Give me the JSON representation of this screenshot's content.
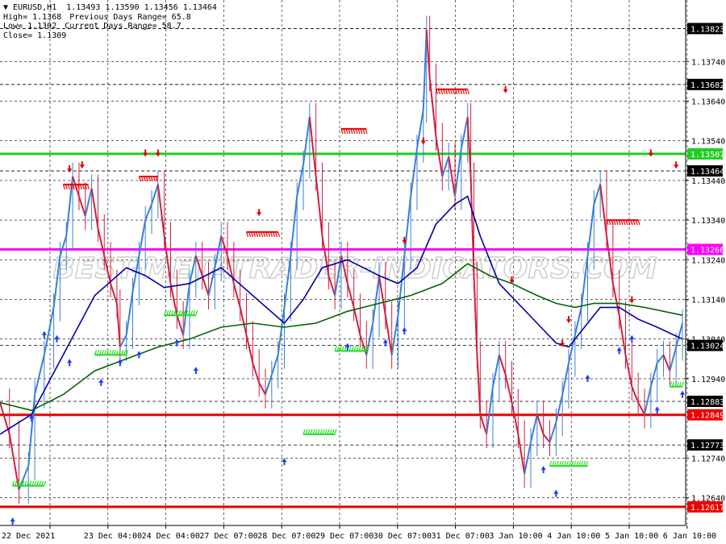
{
  "header": {
    "symbol_line": "▼ EURUSD,H1  1.13493 1.13590 1.13456 1.13464",
    "high": "High= 1.1368",
    "low": "Low= 1.1302",
    "close": "Close= 1.1309",
    "prev_range": "Previous Days Range= 65.8",
    "curr_range": "Current Days Range= 58.7"
  },
  "watermark": "BEST-METATRADER-INDICATORS.COM",
  "chart_data": {
    "type": "line",
    "ylim": [
      1.1257,
      1.13895
    ],
    "price_ticks": [
      "1.13740",
      "1.13640",
      "1.13540",
      "1.13440",
      "1.13340",
      "1.13240",
      "1.13140",
      "1.13040",
      "1.12940",
      "1.12740",
      "1.12640"
    ],
    "x_labels": [
      "22 Dec 2021",
      "23 Dec 04:00",
      "24 Dec 04:00",
      "27 Dec 07:00",
      "28 Dec 07:00",
      "29 Dec 07:00",
      "30 Dec 07:00",
      "31 Dec 07:00",
      "3 Jan 10:00",
      "4 Jan 10:00",
      "5 Jan 10:00",
      "6 Jan 10:00"
    ],
    "levels": [
      {
        "value": 1.13507,
        "label": "1.13507",
        "color": "#22cc22",
        "style": "solid"
      },
      {
        "value": 1.13266,
        "label": "1.13266",
        "color": "#ff00ff",
        "style": "solid"
      },
      {
        "value": 1.12849,
        "label": "1.12849",
        "color": "#ee0000",
        "style": "solid"
      },
      {
        "value": 1.12617,
        "label": "1.12617",
        "color": "#ee0000",
        "style": "solid"
      },
      {
        "value": 1.13823,
        "label": "1.13823",
        "color": "#000000",
        "style": "dashed"
      },
      {
        "value": 1.13682,
        "label": "1.13682",
        "color": "#000000",
        "style": "dashed"
      },
      {
        "value": 1.13464,
        "label": "1.13464",
        "color": "#000000",
        "style": "dashed"
      },
      {
        "value": 1.13024,
        "label": "1.13024",
        "color": "#000000",
        "style": "dashed"
      },
      {
        "value": 1.12883,
        "label": "1.12883",
        "color": "#000000",
        "style": "dashed"
      },
      {
        "value": 1.12773,
        "label": "1.12773",
        "color": "#000000",
        "style": "dashed"
      }
    ],
    "price_path": [
      [
        0,
        1.1288
      ],
      [
        3,
        1.128
      ],
      [
        6,
        1.1266
      ],
      [
        9,
        1.1272
      ],
      [
        11,
        1.129
      ],
      [
        14,
        1.13
      ],
      [
        17,
        1.1312
      ],
      [
        19,
        1.1325
      ],
      [
        21,
        1.133
      ],
      [
        23,
        1.1345
      ],
      [
        25,
        1.134
      ],
      [
        27,
        1.1335
      ],
      [
        29,
        1.1342
      ],
      [
        31,
        1.1332
      ],
      [
        33,
        1.1325
      ],
      [
        35,
        1.1318
      ],
      [
        37,
        1.1313
      ],
      [
        38,
        1.1302
      ],
      [
        40,
        1.1305
      ],
      [
        42,
        1.1316
      ],
      [
        44,
        1.1325
      ],
      [
        46,
        1.1334
      ],
      [
        48,
        1.1338
      ],
      [
        50,
        1.1343
      ],
      [
        52,
        1.133
      ],
      [
        54,
        1.1318
      ],
      [
        56,
        1.131
      ],
      [
        58,
        1.1305
      ],
      [
        60,
        1.1318
      ],
      [
        62,
        1.1325
      ],
      [
        64,
        1.132
      ],
      [
        66,
        1.1315
      ],
      [
        68,
        1.1322
      ],
      [
        70,
        1.133
      ],
      [
        72,
        1.1325
      ],
      [
        74,
        1.1318
      ],
      [
        76,
        1.1312
      ],
      [
        78,
        1.1305
      ],
      [
        80,
        1.1298
      ],
      [
        82,
        1.1293
      ],
      [
        84,
        1.129
      ],
      [
        86,
        1.1295
      ],
      [
        88,
        1.13
      ],
      [
        90,
        1.1312
      ],
      [
        92,
        1.1325
      ],
      [
        94,
        1.134
      ],
      [
        96,
        1.1348
      ],
      [
        98,
        1.136
      ],
      [
        100,
        1.1345
      ],
      [
        102,
        1.133
      ],
      [
        104,
        1.132
      ],
      [
        106,
        1.1315
      ],
      [
        108,
        1.1325
      ],
      [
        110,
        1.1318
      ],
      [
        112,
        1.1312
      ],
      [
        114,
        1.1305
      ],
      [
        116,
        1.13
      ],
      [
        118,
        1.1308
      ],
      [
        120,
        1.132
      ],
      [
        122,
        1.131
      ],
      [
        124,
        1.13
      ],
      [
        126,
        1.131
      ],
      [
        128,
        1.1325
      ],
      [
        130,
        1.134
      ],
      [
        132,
        1.1352
      ],
      [
        134,
        1.1362
      ],
      [
        135,
        1.1382
      ],
      [
        136,
        1.137
      ],
      [
        138,
        1.1355
      ],
      [
        140,
        1.1345
      ],
      [
        142,
        1.135
      ],
      [
        144,
        1.134
      ],
      [
        146,
        1.1352
      ],
      [
        148,
        1.136
      ],
      [
        149,
        1.1345
      ],
      [
        150,
        1.132
      ],
      [
        151,
        1.13
      ],
      [
        152,
        1.1285
      ],
      [
        154,
        1.128
      ],
      [
        156,
        1.1292
      ],
      [
        158,
        1.13
      ],
      [
        160,
        1.1295
      ],
      [
        162,
        1.1288
      ],
      [
        164,
        1.128
      ],
      [
        166,
        1.127
      ],
      [
        168,
        1.1278
      ],
      [
        170,
        1.1285
      ],
      [
        172,
        1.128
      ],
      [
        174,
        1.1278
      ],
      [
        176,
        1.1283
      ],
      [
        178,
        1.129
      ],
      [
        180,
        1.1298
      ],
      [
        182,
        1.1305
      ],
      [
        184,
        1.1312
      ],
      [
        186,
        1.1325
      ],
      [
        188,
        1.1338
      ],
      [
        190,
        1.1343
      ],
      [
        192,
        1.133
      ],
      [
        194,
        1.1318
      ],
      [
        196,
        1.131
      ],
      [
        198,
        1.13
      ],
      [
        200,
        1.1292
      ],
      [
        202,
        1.1288
      ],
      [
        204,
        1.1285
      ],
      [
        206,
        1.1292
      ],
      [
        208,
        1.1298
      ],
      [
        210,
        1.13
      ],
      [
        212,
        1.1296
      ],
      [
        214,
        1.1302
      ],
      [
        216,
        1.1308
      ]
    ],
    "series": [
      {
        "name": "",
        "color": "#0000aa",
        "points": [
          [
            0,
            1.128
          ],
          [
            10,
            1.1285
          ],
          [
            20,
            1.13
          ],
          [
            30,
            1.1315
          ],
          [
            40,
            1.1322
          ],
          [
            46,
            1.132
          ],
          [
            52,
            1.1317
          ],
          [
            60,
            1.1318
          ],
          [
            70,
            1.1322
          ],
          [
            80,
            1.1315
          ],
          [
            90,
            1.1308
          ],
          [
            96,
            1.1314
          ],
          [
            102,
            1.1322
          ],
          [
            110,
            1.1324
          ],
          [
            120,
            1.132
          ],
          [
            126,
            1.1318
          ],
          [
            132,
            1.1322
          ],
          [
            138,
            1.1333
          ],
          [
            144,
            1.1338
          ],
          [
            148,
            1.134
          ],
          [
            152,
            1.133
          ],
          [
            158,
            1.1318
          ],
          [
            164,
            1.1313
          ],
          [
            170,
            1.1308
          ],
          [
            176,
            1.1303
          ],
          [
            180,
            1.1302
          ],
          [
            186,
            1.1308
          ],
          [
            190,
            1.1312
          ],
          [
            196,
            1.1312
          ],
          [
            202,
            1.1309
          ],
          [
            208,
            1.1307
          ],
          [
            216,
            1.1304
          ]
        ]
      },
      {
        "name": "",
        "color": "#006400",
        "points": [
          [
            0,
            1.1288
          ],
          [
            10,
            1.1286
          ],
          [
            20,
            1.129
          ],
          [
            30,
            1.1296
          ],
          [
            40,
            1.1299
          ],
          [
            50,
            1.1302
          ],
          [
            60,
            1.1304
          ],
          [
            70,
            1.1307
          ],
          [
            80,
            1.1308
          ],
          [
            90,
            1.1307
          ],
          [
            100,
            1.1308
          ],
          [
            110,
            1.1311
          ],
          [
            120,
            1.1313
          ],
          [
            130,
            1.1315
          ],
          [
            140,
            1.1318
          ],
          [
            148,
            1.1323
          ],
          [
            155,
            1.132
          ],
          [
            162,
            1.1318
          ],
          [
            170,
            1.1315
          ],
          [
            176,
            1.1313
          ],
          [
            182,
            1.1312
          ],
          [
            188,
            1.1313
          ],
          [
            196,
            1.1313
          ],
          [
            204,
            1.1312
          ],
          [
            216,
            1.131
          ]
        ]
      }
    ],
    "buy_signals": [
      [
        4,
        1.1258
      ],
      [
        10,
        1.1284
      ],
      [
        14,
        1.1305
      ],
      [
        18,
        1.1304
      ],
      [
        22,
        1.1298
      ],
      [
        32,
        1.1293
      ],
      [
        38,
        1.1298
      ],
      [
        44,
        1.13
      ],
      [
        56,
        1.1303
      ],
      [
        62,
        1.1296
      ],
      [
        90,
        1.1273
      ],
      [
        110,
        1.1302
      ],
      [
        122,
        1.1303
      ],
      [
        128,
        1.1306
      ],
      [
        172,
        1.1271
      ],
      [
        176,
        1.1265
      ],
      [
        186,
        1.1294
      ],
      [
        196,
        1.1301
      ],
      [
        200,
        1.1304
      ],
      [
        208,
        1.1286
      ],
      [
        216,
        1.129
      ]
    ],
    "sell_signals": [
      [
        22,
        1.1347
      ],
      [
        26,
        1.1348
      ],
      [
        46,
        1.1351
      ],
      [
        50,
        1.1351
      ],
      [
        82,
        1.1336
      ],
      [
        128,
        1.1329
      ],
      [
        134,
        1.1354
      ],
      [
        160,
        1.1367
      ],
      [
        162,
        1.1319
      ],
      [
        178,
        1.1303
      ],
      [
        180,
        1.1309
      ],
      [
        200,
        1.1314
      ],
      [
        206,
        1.1351
      ],
      [
        214,
        1.1348
      ]
    ],
    "trend_stops": [
      {
        "x": 4,
        "x2": 14,
        "value": 1.1267,
        "color": "#22dd22"
      },
      {
        "x": 30,
        "x2": 40,
        "value": 1.13,
        "color": "#22dd22"
      },
      {
        "x": 52,
        "x2": 62,
        "value": 1.131,
        "color": "#22dd22"
      },
      {
        "x": 106,
        "x2": 116,
        "value": 1.1301,
        "color": "#22dd22"
      },
      {
        "x": 96,
        "x2": 106,
        "value": 1.128,
        "color": "#22dd22"
      },
      {
        "x": 174,
        "x2": 186,
        "value": 1.1272,
        "color": "#22dd22"
      },
      {
        "x": 212,
        "x2": 216,
        "value": 1.1292,
        "color": "#22dd22"
      },
      {
        "x": 20,
        "x2": 28,
        "value": 1.1343,
        "color": "#ee0000"
      },
      {
        "x": 44,
        "x2": 50,
        "value": 1.1345,
        "color": "#ee0000"
      },
      {
        "x": 78,
        "x2": 88,
        "value": 1.1331,
        "color": "#ee0000"
      },
      {
        "x": 108,
        "x2": 116,
        "value": 1.1357,
        "color": "#ee0000"
      },
      {
        "x": 138,
        "x2": 148,
        "value": 1.1367,
        "color": "#ee0000"
      },
      {
        "x": 192,
        "x2": 202,
        "value": 1.1334,
        "color": "#ee0000"
      }
    ],
    "grid": true
  }
}
